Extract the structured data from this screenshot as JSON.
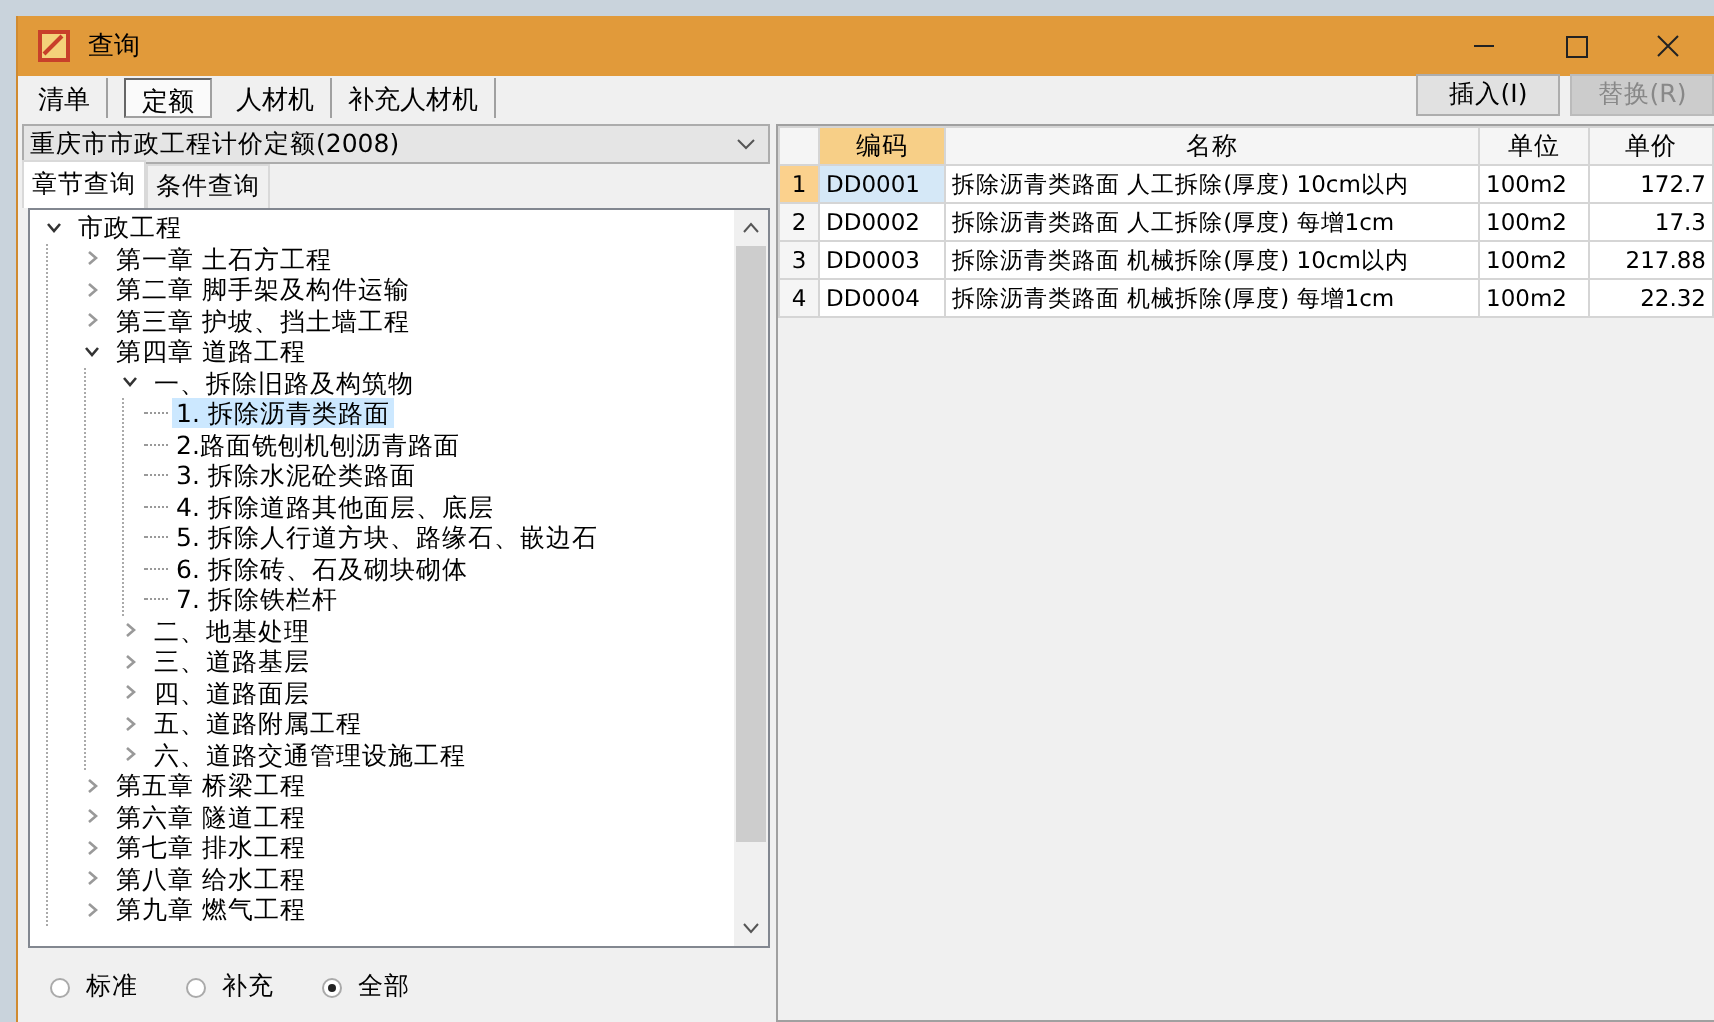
{
  "window": {
    "title": "查询"
  },
  "tabs": [
    {
      "label": "清单",
      "selected": false
    },
    {
      "label": "定额",
      "selected": true
    },
    {
      "label": "人材机",
      "selected": false
    },
    {
      "label": "补充人材机",
      "selected": false
    }
  ],
  "library": {
    "value": "重庆市市政工程计价定额(2008)"
  },
  "search_tabs": [
    {
      "label": "章节查询",
      "selected": true
    },
    {
      "label": "条件查询",
      "selected": false
    }
  ],
  "tree": [
    {
      "label": "市政工程",
      "expanded": true,
      "children": [
        {
          "label": "第一章  土石方工程",
          "expanded": false
        },
        {
          "label": "第二章  脚手架及构件运输",
          "expanded": false
        },
        {
          "label": "第三章  护坡、挡土墙工程",
          "expanded": false
        },
        {
          "label": "第四章  道路工程",
          "expanded": true,
          "children": [
            {
              "label": "一、拆除旧路及构筑物",
              "expanded": true,
              "children": [
                {
                  "label": "1. 拆除沥青类路面",
                  "selected": true
                },
                {
                  "label": "2.路面铣刨机刨沥青路面",
                  "selected": false
                },
                {
                  "label": "3. 拆除水泥砼类路面",
                  "selected": false
                },
                {
                  "label": "4. 拆除道路其他面层、底层",
                  "selected": false
                },
                {
                  "label": "5. 拆除人行道方块、路缘石、嵌边石",
                  "selected": false
                },
                {
                  "label": "6. 拆除砖、石及砌块砌体",
                  "selected": false
                },
                {
                  "label": "7. 拆除铁栏杆",
                  "selected": false
                }
              ]
            },
            {
              "label": "二、地基处理",
              "expanded": false
            },
            {
              "label": "三、道路基层",
              "expanded": false
            },
            {
              "label": "四、道路面层",
              "expanded": false
            },
            {
              "label": "五、道路附属工程",
              "expanded": false
            },
            {
              "label": "六、道路交通管理设施工程",
              "expanded": false
            }
          ]
        },
        {
          "label": "第五章  桥梁工程",
          "expanded": false
        },
        {
          "label": "第六章  隧道工程",
          "expanded": false
        },
        {
          "label": "第七章  排水工程",
          "expanded": false
        },
        {
          "label": "第八章  给水工程",
          "expanded": false
        },
        {
          "label": "第九章  燃气工程",
          "expanded": false
        }
      ]
    }
  ],
  "filter": [
    {
      "label": "标准",
      "selected": false
    },
    {
      "label": "补充",
      "selected": false
    },
    {
      "label": "全部",
      "selected": true
    }
  ],
  "buttons": [
    {
      "label": "插入(I)",
      "disabled": false
    },
    {
      "label": "替换(R)",
      "disabled": true
    }
  ],
  "table": {
    "columns": [
      "编码",
      "名称",
      "单位",
      "单价"
    ],
    "rows": [
      {
        "number": "1",
        "code": "DD0001",
        "name": "拆除沥青类路面 人工拆除(厚度) 10cm以内",
        "unit": "100m2",
        "price": "172.7",
        "selected": true
      },
      {
        "number": "2",
        "code": "DD0002",
        "name": "拆除沥青类路面 人工拆除(厚度) 每增1cm",
        "unit": "100m2",
        "price": "17.3",
        "selected": false
      },
      {
        "number": "3",
        "code": "DD0003",
        "name": "拆除沥青类路面 机械拆除(厚度) 10cm以内",
        "unit": "100m2",
        "price": "217.88",
        "selected": false
      },
      {
        "number": "4",
        "code": "DD0004",
        "name": "拆除沥青类路面 机械拆除(厚度) 每增1cm",
        "unit": "100m2",
        "price": "22.32",
        "selected": false
      }
    ]
  }
}
